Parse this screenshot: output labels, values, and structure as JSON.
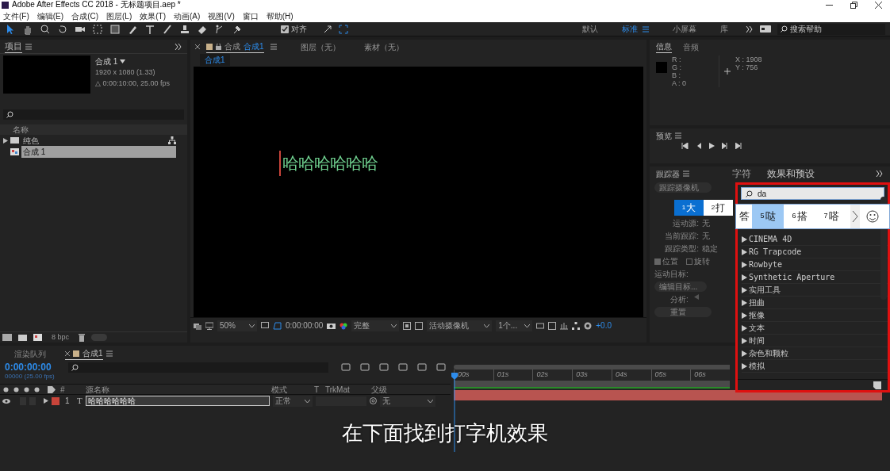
{
  "window": {
    "title": "Adobe After Effects CC 2018 - 无标题项目.aep *"
  },
  "menu": [
    "文件(F)",
    "编辑(E)",
    "合成(C)",
    "图层(L)",
    "效果(T)",
    "动画(A)",
    "视图(V)",
    "窗口",
    "帮助(H)"
  ],
  "toolbar": {
    "snap": {
      "label": "对齐",
      "checked": true
    }
  },
  "workspaces": [
    {
      "label": "默认",
      "selected": false
    },
    {
      "label": "标准",
      "selected": true
    },
    {
      "label": "小屏幕",
      "selected": false
    },
    {
      "label": "库",
      "selected": false
    }
  ],
  "help_search": {
    "placeholder": "搜索帮助"
  },
  "project": {
    "tab": "项目",
    "comp_name": "合成 1",
    "comp_size": "1920 x 1080 (1.33)",
    "comp_duration": "△ 0:00:10:00, 25.00 fps",
    "column": "名称",
    "items": [
      {
        "kind": "folder",
        "name": "纯色",
        "selected": false
      },
      {
        "kind": "comp",
        "name": "合成 1",
        "selected": true
      }
    ],
    "bpc": "8 bpc"
  },
  "viewer": {
    "tabs": [
      {
        "prefix": "合成",
        "label": "合成1",
        "selected": true
      },
      {
        "label": "图层（无）",
        "selected": false
      },
      {
        "label": "素材（无）",
        "selected": false
      }
    ],
    "breadcrumb": "合成1",
    "canvas_text": "哈哈哈哈哈哈",
    "zoom": "50%",
    "timecode": "0:00:00:00",
    "resolution": "完整",
    "camera": "活动摄像机",
    "views": "1个...",
    "exposure": "+0.0"
  },
  "info": {
    "tabs": [
      {
        "label": "信息",
        "selected": true
      },
      {
        "label": "音频",
        "selected": false
      }
    ],
    "channels": [
      "R :",
      "G :",
      "B :",
      "A : 0"
    ],
    "x": "X : 1908",
    "y": "Y : 756"
  },
  "preview": {
    "title": "预览"
  },
  "tracker": {
    "title": "跟踪器",
    "buttons": [
      "跟踪摄像机"
    ],
    "fields": [
      {
        "label": "运动源:",
        "value": "无"
      },
      {
        "label": "当前跟踪:",
        "value": "无"
      },
      {
        "label": "跟踪类型:",
        "value": "稳定"
      }
    ],
    "checks": [
      {
        "label": "位置",
        "checked": true
      },
      {
        "label": "旋转",
        "checked": false
      }
    ],
    "target": "运动目标:",
    "edit_target": "编辑目标...",
    "analyze": "分析:",
    "reset": "重置"
  },
  "right_tabs": [
    {
      "label": "字符",
      "selected": false
    },
    {
      "label": "效果和预设",
      "selected": true
    }
  ],
  "effects": {
    "search": "da",
    "items": [
      "CINEMA 4D",
      "RG Trapcode",
      "Rowbyte",
      "Synthetic Aperture",
      "实用工具",
      "扭曲",
      "抠像",
      "文本",
      "时间",
      "杂色和颗粒",
      "模拟"
    ]
  },
  "ime": {
    "candidates_left": [
      {
        "index": "1",
        "char": "大",
        "selected": true
      },
      {
        "index": "2",
        "char": "打",
        "selected": false
      }
    ],
    "candidates_right": [
      {
        "char": "答",
        "selected": false
      },
      {
        "index": "5",
        "char": "哒",
        "selected": true
      },
      {
        "index": "6",
        "char": "搭",
        "selected": false
      },
      {
        "index": "7",
        "char": "嗒",
        "selected": false
      }
    ]
  },
  "timeline": {
    "tabs": [
      {
        "label": "渲染队列",
        "selected": false
      },
      {
        "label": "合成1",
        "selected": true
      }
    ],
    "timecode": "0:00:00:00",
    "fps": "00000 (25.00 fps)",
    "columns": [
      "#",
      "源名称",
      "模式",
      "T",
      "TrkMat",
      "父级"
    ],
    "layers": [
      {
        "number": "1",
        "type_glyph": "T",
        "name": "哈哈哈哈哈哈",
        "mode": "正常",
        "parent": "无",
        "color": "#c8443a",
        "selected": true
      }
    ],
    "ruler": [
      "00s",
      "01s",
      "02s",
      "03s",
      "04s",
      "05s",
      "06s"
    ]
  },
  "caption": "在下面找到打字机效果"
}
